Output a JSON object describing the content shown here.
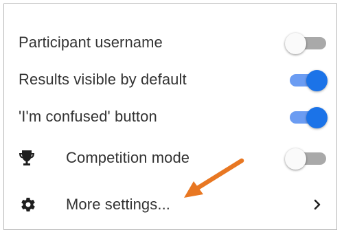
{
  "settings": {
    "items": [
      {
        "label": "Participant username",
        "toggle": "off"
      },
      {
        "label": "Results visible by default",
        "toggle": "on"
      },
      {
        "label": "'I'm confused' button",
        "toggle": "on"
      },
      {
        "label": "Competition mode",
        "toggle": "off",
        "icon": "trophy-icon"
      },
      {
        "label": "More settings...",
        "icon": "gear-icon",
        "trailing_icon": "chevron-right-icon"
      }
    ]
  },
  "annotation": {
    "icon": "arrow-annotation-icon",
    "color": "#e87722"
  },
  "colors": {
    "toggle_on_track": "#6b9cf2",
    "toggle_on_knob": "#1b73e8",
    "toggle_off_track": "#a9a9a9",
    "text": "#333333"
  }
}
